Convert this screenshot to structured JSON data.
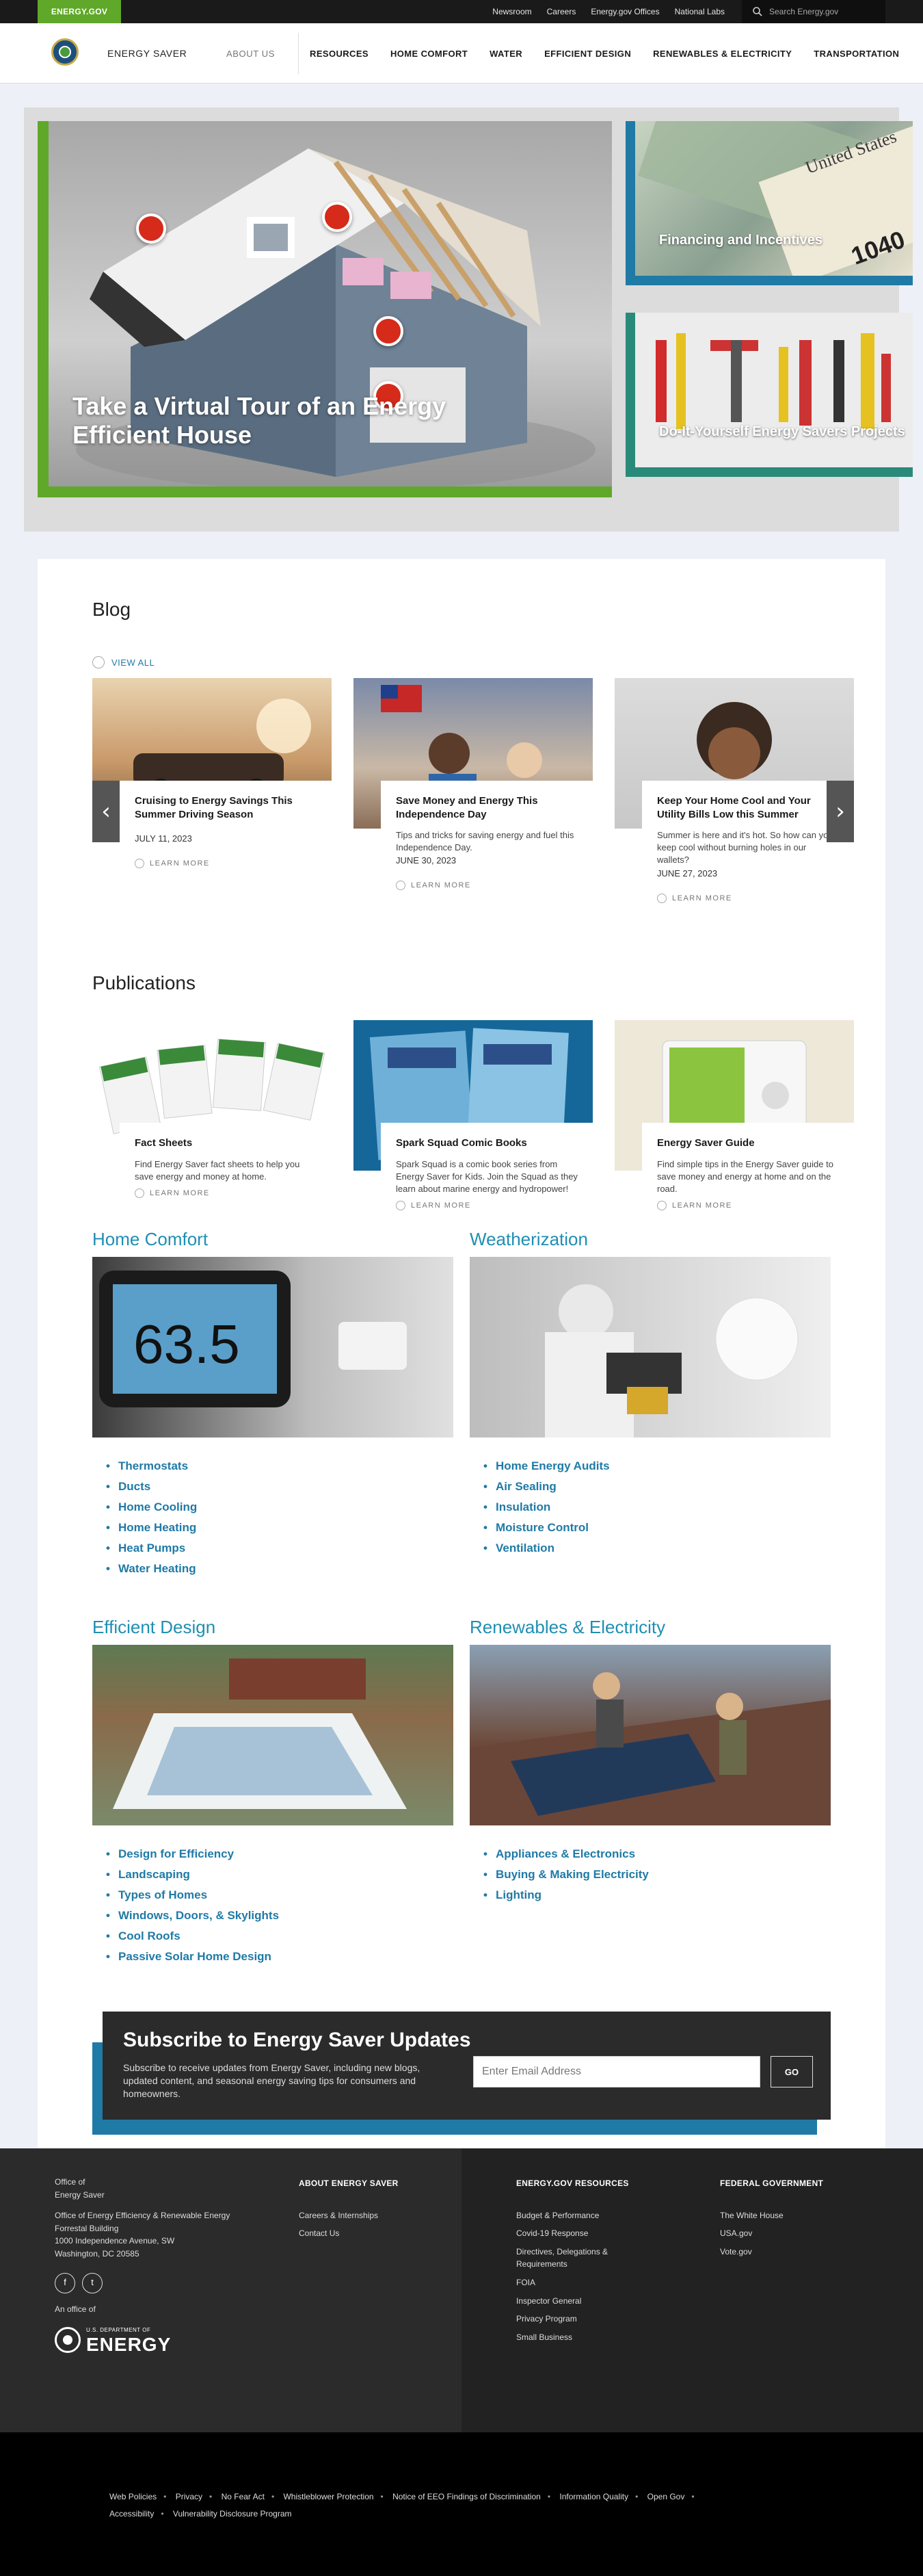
{
  "topbar": {
    "brand": "ENERGY.GOV",
    "links": [
      "Newsroom",
      "Careers",
      "Energy.gov Offices",
      "National Labs"
    ],
    "search_placeholder": "Search Energy.gov"
  },
  "nav": {
    "site_name": "ENERGY SAVER",
    "about": "ABOUT US",
    "items": [
      "RESOURCES",
      "HOME COMFORT",
      "WATER",
      "EFFICIENT DESIGN",
      "RENEWABLES & ELECTRICITY",
      "TRANSPORTATION"
    ]
  },
  "hero": {
    "main_title": "Take a Virtual Tour of an Energy Efficient House",
    "cards": [
      {
        "label": "Financing and Incentives"
      },
      {
        "label": "Do-It-Yourself Energy Savers Projects"
      }
    ]
  },
  "blog": {
    "title": "Blog",
    "view_all": "VIEW ALL",
    "learn_more": "LEARN MORE",
    "posts": [
      {
        "title": "Cruising to Energy Savings This Summer Driving Season",
        "desc": "",
        "date": "JULY 11, 2023"
      },
      {
        "title": "Save Money and Energy This Independence Day",
        "desc": "Tips and tricks for saving energy and fuel this Independence Day.",
        "date": "JUNE 30, 2023"
      },
      {
        "title": "Keep Your Home Cool and Your Utility Bills Low this Summer",
        "desc": "Summer is here and it's hot. So how can you keep cool without burning holes in our wallets?",
        "date": "JUNE 27, 2023"
      }
    ]
  },
  "publications": {
    "title": "Publications",
    "learn_more": "LEARN MORE",
    "items": [
      {
        "title": "Fact Sheets",
        "desc": "Find Energy Saver fact sheets to help you save energy and money at home."
      },
      {
        "title": "Spark Squad Comic Books",
        "desc": "Spark Squad is a comic book series from Energy Saver for Kids. Join the Squad as they learn about marine energy and hydropower!"
      },
      {
        "title": "Energy Saver Guide",
        "desc": "Find simple tips in the Energy Saver guide to save money and energy at home and on the road."
      }
    ]
  },
  "topics": [
    {
      "title": "Home Comfort",
      "links": [
        "Thermostats",
        "Ducts",
        "Home Cooling",
        "Home Heating",
        "Heat Pumps",
        "Water Heating"
      ]
    },
    {
      "title": "Weatherization",
      "links": [
        "Home Energy Audits",
        "Air Sealing",
        "Insulation",
        "Moisture Control",
        "Ventilation"
      ]
    },
    {
      "title": "Efficient Design",
      "links": [
        "Design for Efficiency",
        "Landscaping",
        "Types of Homes",
        "Windows, Doors, & Skylights",
        "Cool Roofs",
        "Passive Solar Home Design"
      ]
    },
    {
      "title": "Renewables & Electricity",
      "links": [
        "Appliances & Electronics",
        "Buying & Making Electricity",
        "Lighting"
      ]
    }
  ],
  "thermostat_reading": "63.5",
  "subscribe": {
    "title": "Subscribe to Energy Saver Updates",
    "text": "Subscribe to receive updates from Energy Saver, including new blogs, updated content, and seasonal energy saving tips for consumers and homeowners.",
    "email_placeholder": "Enter Email Address",
    "button": "GO"
  },
  "footer": {
    "office_lines": [
      "Office of",
      "Energy Saver"
    ],
    "address_lines": [
      "Office of Energy Efficiency & Renewable Energy",
      "Forrestal Building",
      "1000 Independence Avenue, SW",
      "Washington, DC 20585"
    ],
    "an_office_of": "An office of",
    "doe_small": "U.S. DEPARTMENT OF",
    "doe_big": "ENERGY",
    "about_heading": "ABOUT ENERGY SAVER",
    "about_links": [
      "Careers & Internships",
      "Contact Us"
    ],
    "resources_heading": "ENERGY.GOV RESOURCES",
    "resources_links": [
      "Budget & Performance",
      "Covid-19 Response",
      "Directives, Delegations & Requirements",
      "FOIA",
      "Inspector General",
      "Privacy Program",
      "Small Business"
    ],
    "federal_heading": "FEDERAL GOVERNMENT",
    "federal_links": [
      "The White House",
      "USA.gov",
      "Vote.gov"
    ]
  },
  "subfooter_links": [
    "Web Policies",
    "Privacy",
    "No Fear Act",
    "Whistleblower Protection",
    "Notice of EEO Findings of Discrimination",
    "Information Quality",
    "Open Gov",
    "Accessibility",
    "Vulnerability Disclosure Program"
  ],
  "colors": {
    "green": "#5fa829",
    "blue": "#1f7aa6",
    "teal": "#2a8a7a",
    "dark": "#2b2b2b"
  }
}
